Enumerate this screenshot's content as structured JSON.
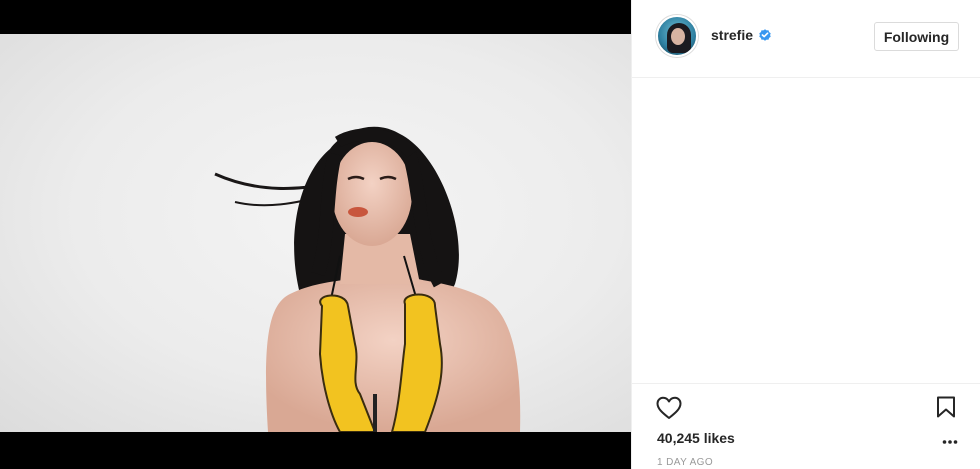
{
  "post": {
    "author": {
      "username": "strefie",
      "verified": true
    },
    "follow_button_label": "Following",
    "likes_text": "40,245 likes",
    "date_text": "1 DAY AGO"
  },
  "icons": {
    "avatar": "profile-avatar",
    "verified": "verified-badge-icon",
    "like": "heart-icon",
    "save": "bookmark-icon",
    "more": "more-options-icon"
  },
  "colors": {
    "verified_blue": "#3897f0",
    "text_primary": "#262626",
    "text_secondary": "#999999",
    "border": "#dbdbdb",
    "media_background": "#000000"
  }
}
